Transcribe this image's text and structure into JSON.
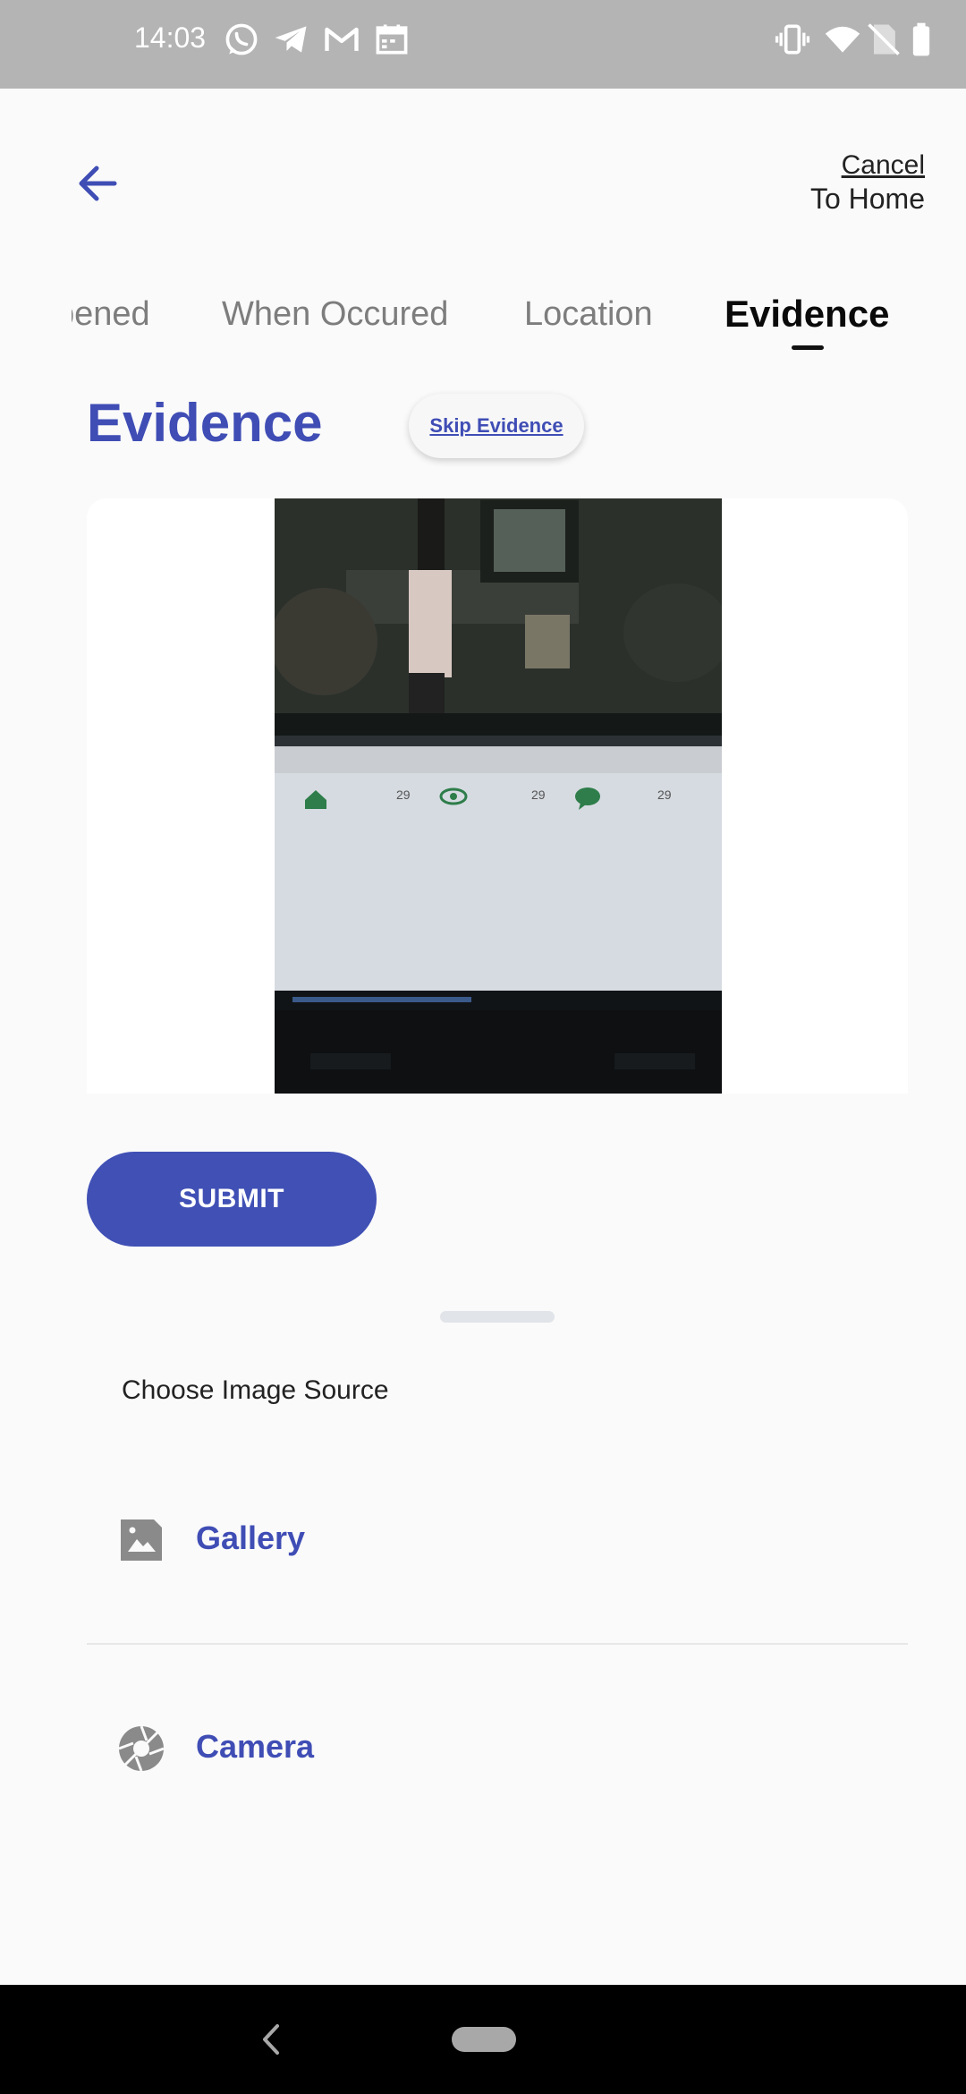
{
  "status_bar": {
    "time": "14:03",
    "notification_icons": [
      "whatsapp-icon",
      "telegram-icon",
      "gmail-icon",
      "calendar-icon"
    ],
    "system_icons": [
      "vibrate-icon",
      "wifi-icon",
      "no-sim-icon",
      "battery-icon"
    ]
  },
  "header": {
    "cancel_label": "Cancel",
    "to_home_label": "To Home"
  },
  "tabs": [
    {
      "label": "pened",
      "active": false
    },
    {
      "label": "When Occured",
      "active": false
    },
    {
      "label": "Location",
      "active": false
    },
    {
      "label": "Evidence",
      "active": true
    }
  ],
  "evidence": {
    "title": "Evidence",
    "skip_label": "Skip Evidence",
    "photo_stats": [
      "29",
      "29",
      "29"
    ]
  },
  "submit_label": "SUBMIT",
  "image_source_sheet": {
    "title": "Choose Image Source",
    "options": [
      {
        "label": "Gallery",
        "icon": "gallery-icon"
      },
      {
        "label": "Camera",
        "icon": "camera-icon"
      }
    ]
  },
  "colors": {
    "accent": "#4050b5",
    "status_bar": "#b4b4b4",
    "background": "#fafafa"
  }
}
